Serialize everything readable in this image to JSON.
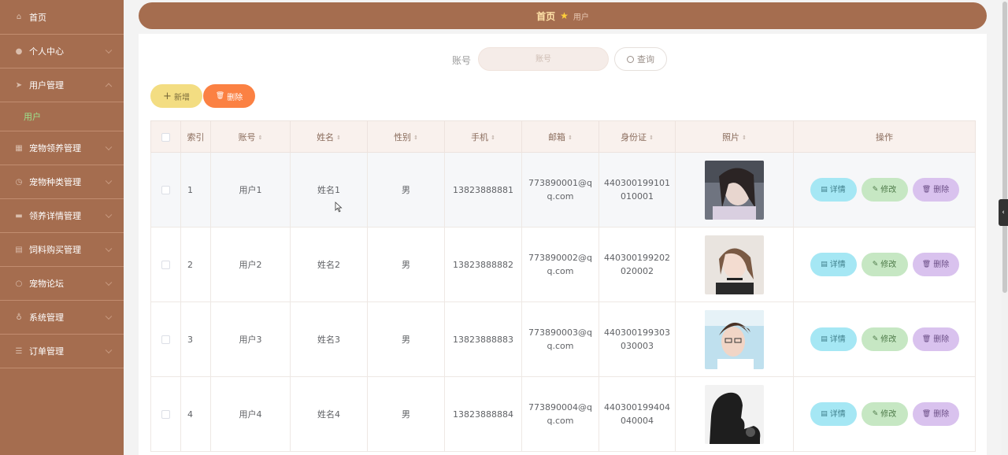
{
  "sidebar": {
    "items": [
      {
        "label": "首页",
        "icon": "home-icon",
        "arrow": ""
      },
      {
        "label": "个人中心",
        "icon": "user-icon",
        "arrow": "down"
      },
      {
        "label": "用户管理",
        "icon": "send-icon",
        "arrow": "up"
      },
      {
        "label": "宠物领养管理",
        "icon": "grid-icon",
        "arrow": "down"
      },
      {
        "label": "宠物种类管理",
        "icon": "clock-icon",
        "arrow": "down"
      },
      {
        "label": "领养详情管理",
        "icon": "monitor-icon",
        "arrow": "down"
      },
      {
        "label": "饲料购买管理",
        "icon": "trash-icon",
        "arrow": "down"
      },
      {
        "label": "宠物论坛",
        "icon": "circle-icon",
        "arrow": "down"
      },
      {
        "label": "系统管理",
        "icon": "location-icon",
        "arrow": "down"
      },
      {
        "label": "订单管理",
        "icon": "list-icon",
        "arrow": "down"
      }
    ],
    "submenu": {
      "label": "用户"
    }
  },
  "breadcrumb": {
    "home": "首页",
    "current": "用户"
  },
  "search": {
    "label": "账号",
    "placeholder": "账号",
    "button_label": "查询"
  },
  "actions": {
    "add_label": "新增",
    "delete_label": "删除"
  },
  "table": {
    "headers": [
      "索引",
      "账号",
      "姓名",
      "性别",
      "手机",
      "邮箱",
      "身份证",
      "照片",
      "操作"
    ],
    "rows": [
      {
        "index": "1",
        "account": "用户1",
        "name": "姓名1",
        "gender": "男",
        "phone": "13823888881",
        "email": "773890001@qq.com",
        "idcard": "440300199101010001"
      },
      {
        "index": "2",
        "account": "用户2",
        "name": "姓名2",
        "gender": "男",
        "phone": "13823888882",
        "email": "773890002@qq.com",
        "idcard": "440300199202020002"
      },
      {
        "index": "3",
        "account": "用户3",
        "name": "姓名3",
        "gender": "男",
        "phone": "13823888883",
        "email": "773890003@qq.com",
        "idcard": "440300199303030003"
      },
      {
        "index": "4",
        "account": "用户4",
        "name": "姓名4",
        "gender": "男",
        "phone": "13823888884",
        "email": "773890004@qq.com",
        "idcard": "440300199404040004"
      }
    ],
    "row_actions": {
      "detail": "详情",
      "edit": "修改",
      "delete": "删除"
    }
  },
  "colors": {
    "brand": "#a56d4f",
    "add": "#f3dd82",
    "delete": "#fb8143",
    "detail": "#a5e7f4",
    "edit": "#c6e7c3",
    "row_delete": "#d9c2ee"
  }
}
